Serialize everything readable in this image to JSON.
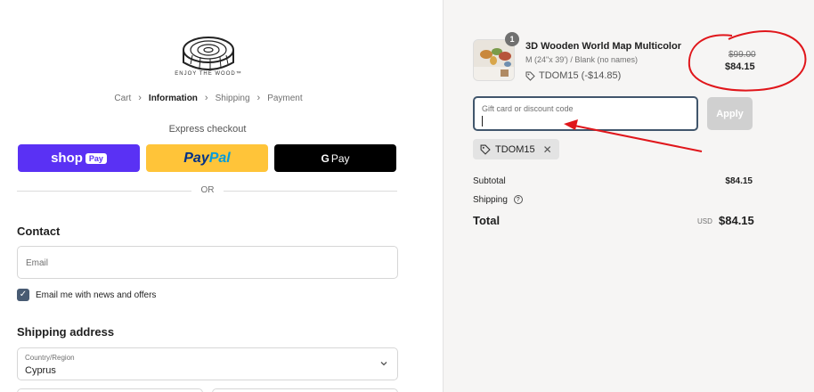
{
  "brand": {
    "logo_text": "ENJOY THE WOOD™"
  },
  "breadcrumb": [
    {
      "label": "Cart"
    },
    {
      "label": "Information",
      "current": true
    },
    {
      "label": "Shipping"
    },
    {
      "label": "Payment"
    }
  ],
  "express": {
    "title": "Express checkout",
    "shop_label": "shop",
    "shop_chip": "Pay",
    "paypal_part1": "Pay",
    "paypal_part2": "Pal",
    "gpay_g": "G",
    "gpay_label": "Pay",
    "or_text": "OR"
  },
  "contact": {
    "heading": "Contact",
    "email_placeholder": "Email",
    "newsletter_label": "Email me with news and offers",
    "newsletter_checked": true
  },
  "shipping": {
    "heading": "Shipping address",
    "country_label": "Country/Region",
    "country_value": "Cyprus"
  },
  "order": {
    "quantity": "1",
    "product_name": "3D Wooden World Map Multicolor",
    "product_variant": "M (24\"x 39') / Blank (no names)",
    "product_discount": "TDOM15 (-$14.85)",
    "old_price": "$99.00",
    "new_price": "$84.15",
    "discount_placeholder": "Gift card or discount code",
    "apply_label": "Apply",
    "applied_code": "TDOM15",
    "subtotal_label": "Subtotal",
    "subtotal_value": "$84.15",
    "shipping_label": "Shipping",
    "total_label": "Total",
    "total_currency": "USD",
    "total_value": "$84.15"
  },
  "colors": {
    "shop_pay": "#5a31f4",
    "paypal": "#ffc439",
    "gpay": "#000000",
    "annotation": "#e0161b",
    "checkbox": "#485b73"
  }
}
